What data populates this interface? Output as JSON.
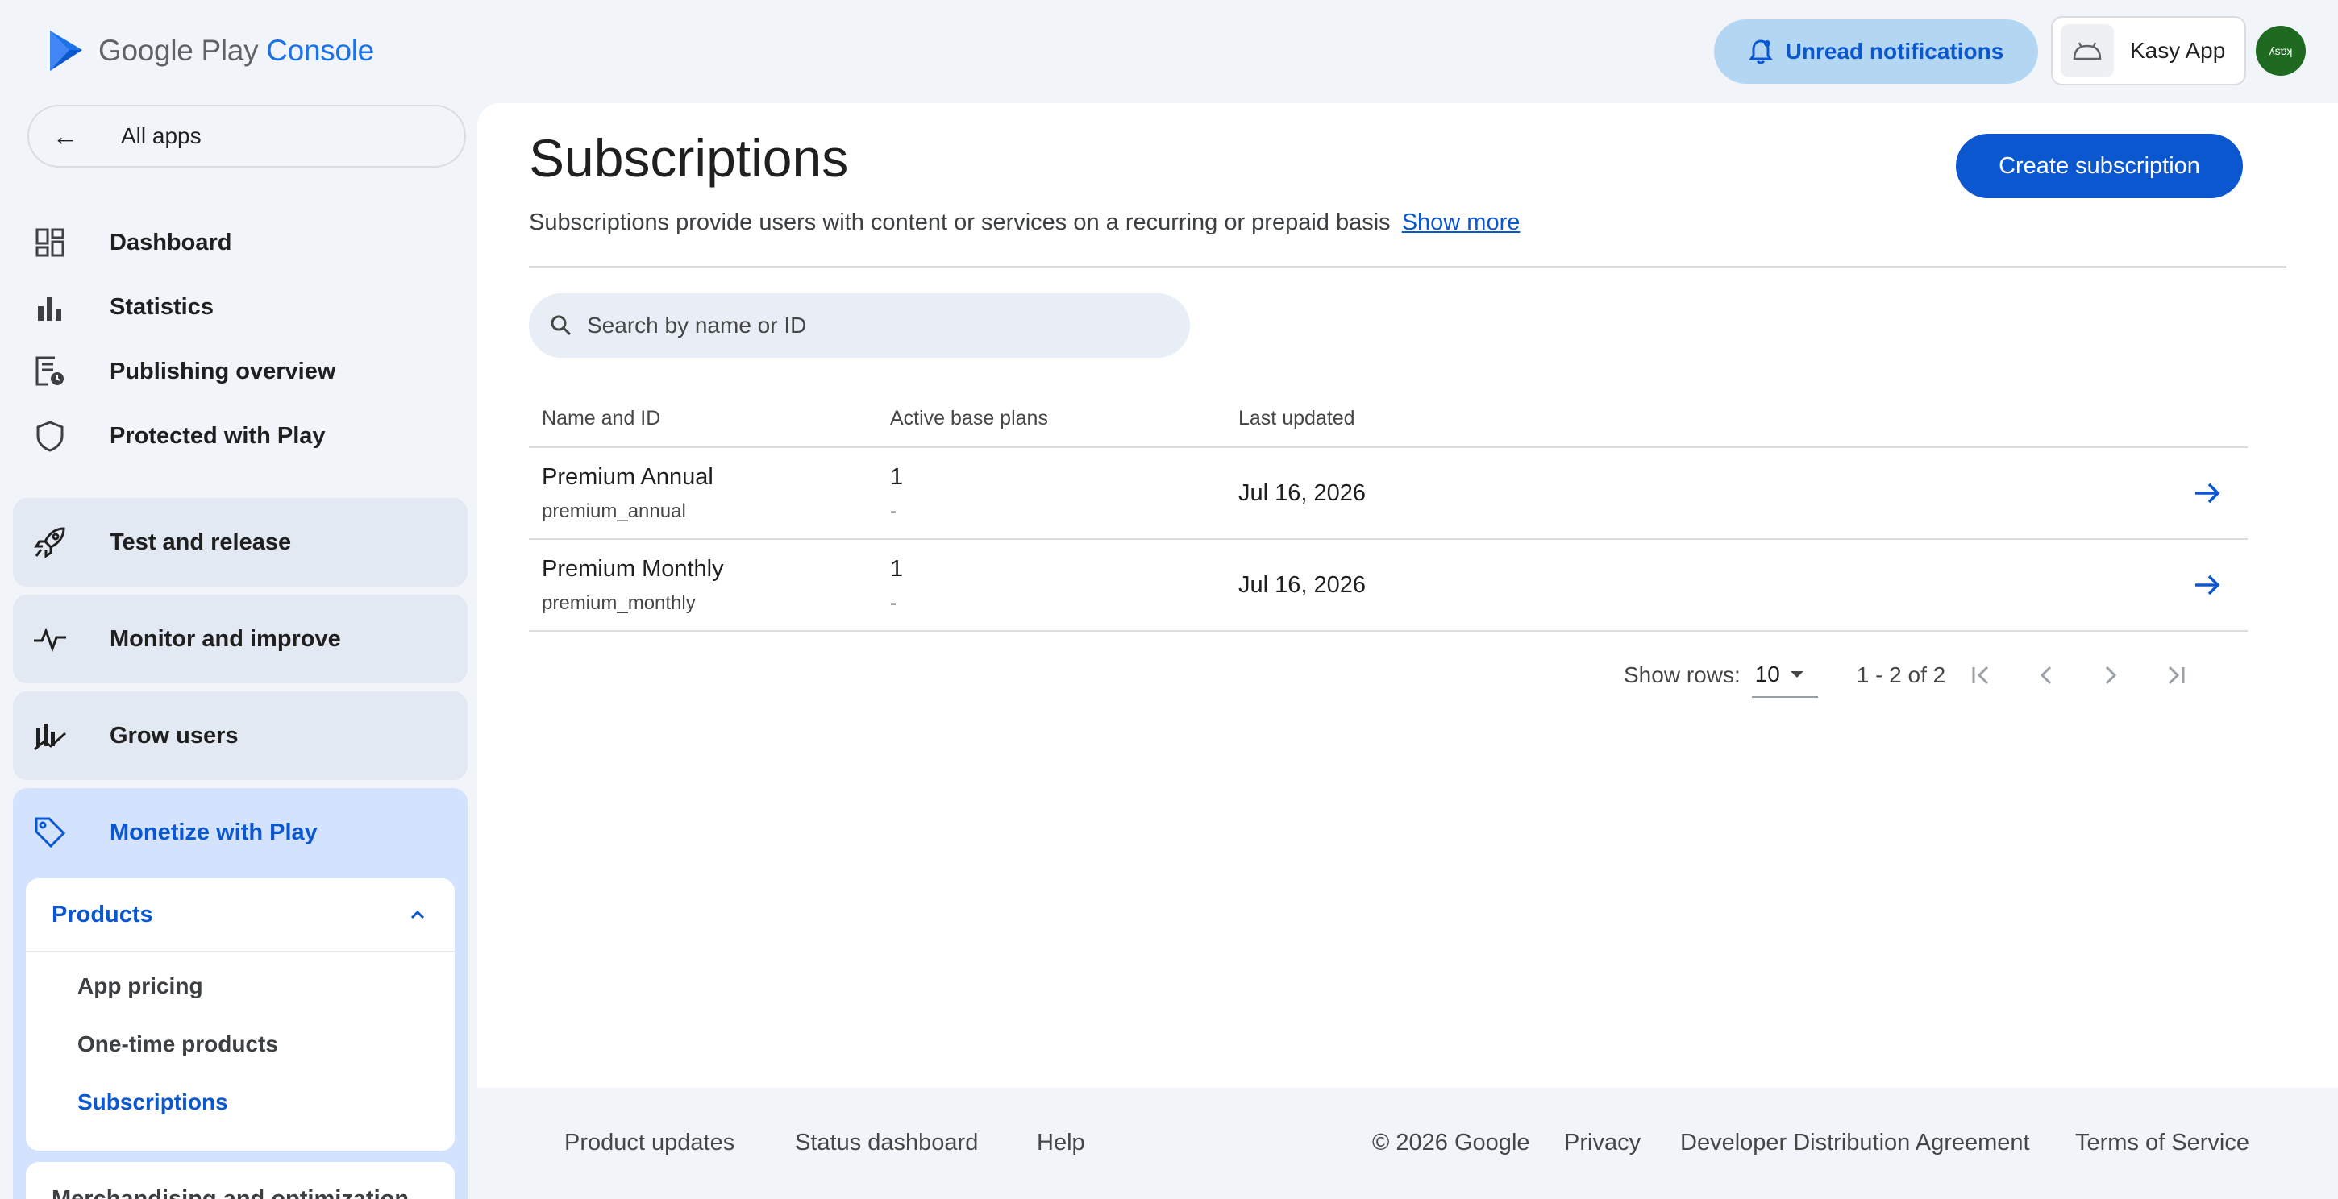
{
  "header": {
    "logo_google_play": "Google Play",
    "logo_console": "Console",
    "notifications_label": "Unread notifications",
    "app_name": "Kasy App",
    "avatar_text": "ʎsɐʞ"
  },
  "sidebar": {
    "all_apps": "All apps",
    "items": [
      {
        "label": "Dashboard"
      },
      {
        "label": "Statistics"
      },
      {
        "label": "Publishing overview"
      },
      {
        "label": "Protected with Play"
      }
    ],
    "sections": [
      {
        "label": "Test and release"
      },
      {
        "label": "Monitor and improve"
      },
      {
        "label": "Grow users"
      }
    ],
    "monetize": {
      "label": "Monetize with Play",
      "products_label": "Products",
      "sub_items": [
        {
          "label": "App pricing"
        },
        {
          "label": "One-time products"
        },
        {
          "label": "Subscriptions"
        }
      ],
      "merch_label": "Merchandising and optimization"
    }
  },
  "main": {
    "title": "Subscriptions",
    "create_button": "Create subscription",
    "description": "Subscriptions provide users with content or services on a recurring or prepaid basis",
    "show_more": "Show more",
    "search_placeholder": "Search by name or ID",
    "table": {
      "headers": [
        "Name and ID",
        "Active base plans",
        "Last updated"
      ],
      "rows": [
        {
          "name": "Premium Annual",
          "id": "premium_annual",
          "active_plans": "1",
          "secondary": "-",
          "updated": "Jul 16, 2026"
        },
        {
          "name": "Premium Monthly",
          "id": "premium_monthly",
          "active_plans": "1",
          "secondary": "-",
          "updated": "Jul 16, 2026"
        }
      ]
    },
    "pager": {
      "show_rows_label": "Show rows:",
      "rows_value": "10",
      "range": "1 - 2 of 2"
    }
  },
  "footer": {
    "product_updates": "Product updates",
    "status_dashboard": "Status dashboard",
    "help": "Help",
    "copyright": "© 2026 Google",
    "privacy": "Privacy",
    "dda": "Developer Distribution Agreement",
    "tos": "Terms of Service"
  },
  "colors": {
    "accent": "#0b57d0",
    "background": "#f1f4f9",
    "monetize_bg": "#d3e3fd"
  },
  "icons": [
    "play-logo-icon",
    "bell-icon",
    "android-icon",
    "back-arrow-icon",
    "dashboard-icon",
    "statistics-icon",
    "publishing-icon",
    "shield-icon",
    "rocket-icon",
    "pulse-icon",
    "growth-icon",
    "tag-icon",
    "chevron-up-icon",
    "search-icon",
    "arrow-right-icon",
    "dropdown-icon",
    "first-page-icon",
    "prev-page-icon",
    "next-page-icon",
    "last-page-icon"
  ]
}
